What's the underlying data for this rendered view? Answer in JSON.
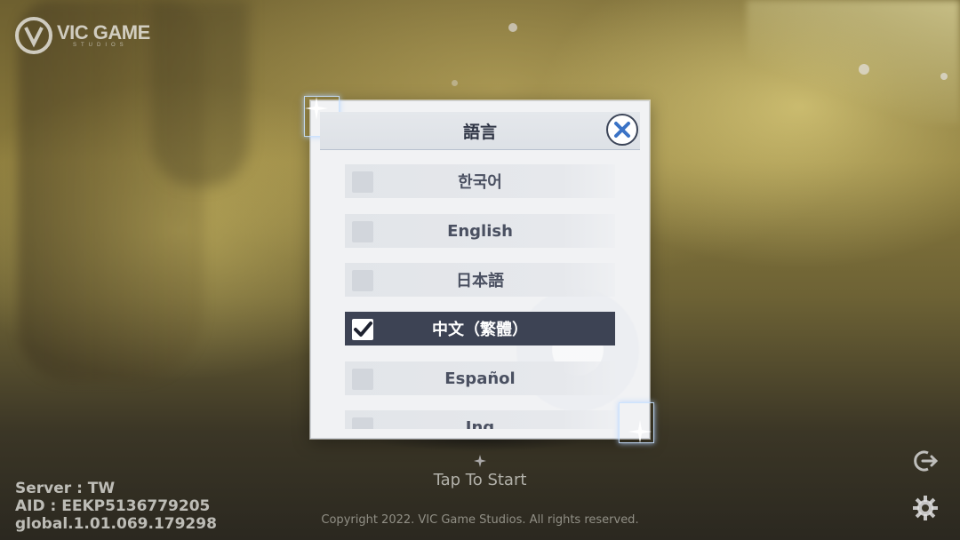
{
  "brand": {
    "name": "VIC GAME",
    "sub": "STUDIOS"
  },
  "dialog": {
    "title": "語言",
    "close_icon": "close-icon",
    "options": [
      {
        "label": "한국어",
        "checked": false
      },
      {
        "label": "English",
        "checked": false
      },
      {
        "label": "日本語",
        "checked": false
      },
      {
        "label": "中文（繁體）",
        "checked": true
      },
      {
        "label": "Español",
        "checked": false
      },
      {
        "label": "Ing",
        "checked": false
      }
    ]
  },
  "start": {
    "label": "Tap To Start"
  },
  "info": {
    "server": "Server : TW",
    "aid": "AID : EEKP5136779205",
    "version": "global.1.01.069.179298"
  },
  "copyright": "Copyright 2022. VIC Game Studios. All rights reserved.",
  "icons": {
    "logout": "logout-icon",
    "settings": "gear-icon"
  },
  "colors": {
    "selected_bg": "#3d4354",
    "close_x": "#3b73c6"
  }
}
